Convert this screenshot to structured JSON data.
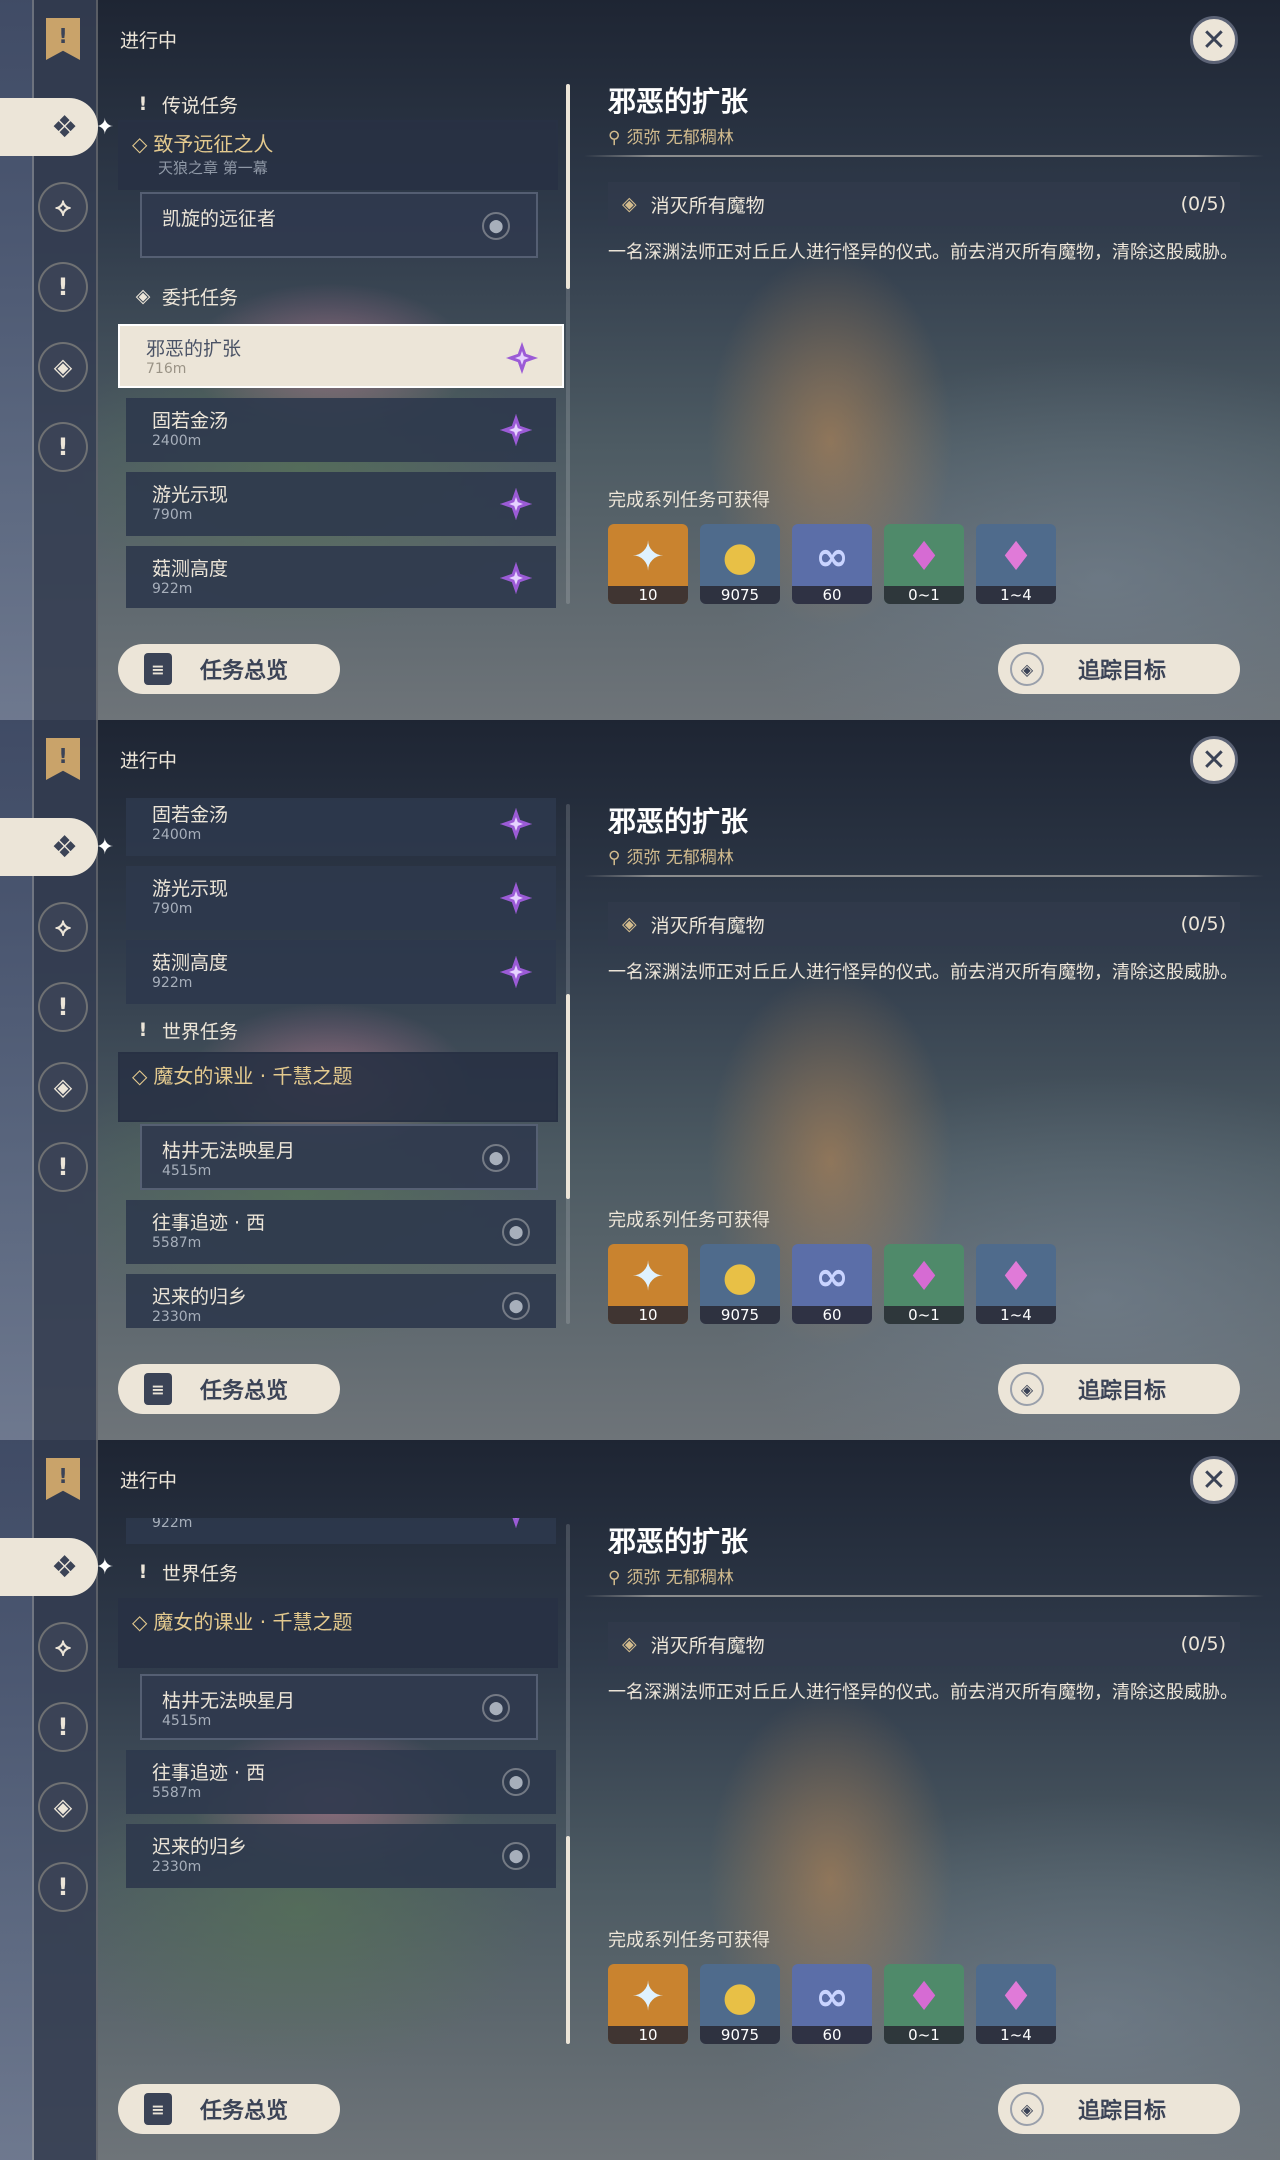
{
  "header": {
    "ongoing_label": "进行中",
    "close_icon": "close-icon"
  },
  "detail": {
    "title": "邪恶的扩张",
    "location": "须弥 无郁稠林",
    "objective": "消灭所有魔物",
    "progress": "(0/5)",
    "description": "一名深渊法师正对丘丘人进行怪异的仪式。前去消灭所有魔物，清除这股威胁。",
    "rewards_label": "完成系列任务可获得",
    "rewards": [
      {
        "name": "primogem-icon",
        "qty": "10",
        "color": "#c9832f"
      },
      {
        "name": "mora-icon",
        "qty": "9075",
        "color": "#4f6b8c"
      },
      {
        "name": "adventure-exp-icon",
        "qty": "60",
        "color": "#5b6ea8"
      },
      {
        "name": "crystal-chunk-icon",
        "qty": "0~1",
        "color": "#4f8a6a"
      },
      {
        "name": "crystal-cluster-icon",
        "qty": "1~4",
        "color": "#4f6b8c"
      }
    ]
  },
  "footer": {
    "overview_label": "任务总览",
    "track_label": "追踪目标"
  },
  "quests": {
    "archon_cat": "传说任务",
    "archon_group": {
      "title": "致予远征之人",
      "subtitle": "天狼之章 第一幕"
    },
    "archon_sub": "凯旋的远征者",
    "commission_cat": "委托任务",
    "c1": {
      "title": "邪恶的扩张",
      "dist": "716m"
    },
    "c2": {
      "title": "固若金汤",
      "dist": "2400m"
    },
    "c3": {
      "title": "游光示现",
      "dist": "790m"
    },
    "c4": {
      "title": "菇测高度",
      "dist": "922m"
    },
    "world_cat": "世界任务",
    "world_group": "魔女的课业 · 千慧之题",
    "w_sub": {
      "title": "枯井无法映星月",
      "dist": "4515m"
    },
    "w2": {
      "title": "往事追迹 · 西",
      "dist": "5587m"
    },
    "w3": {
      "title": "迟来的归乡",
      "dist": "2330m"
    }
  }
}
